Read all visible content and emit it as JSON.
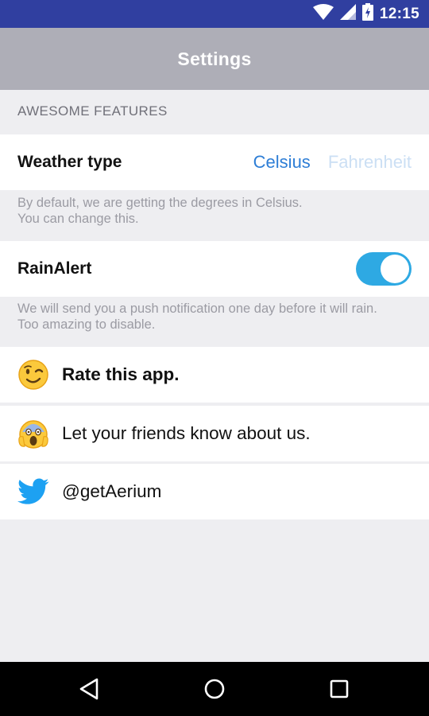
{
  "status_bar": {
    "time": "12:15",
    "icons": [
      "wifi-icon",
      "signal-icon",
      "battery-charging-icon"
    ]
  },
  "app_bar": {
    "title": "Settings"
  },
  "section": {
    "header": "AWESOME FEATURES"
  },
  "weather": {
    "label": "Weather type",
    "options": [
      "Celsius",
      "Fahrenheit"
    ],
    "selected": "Celsius",
    "hint_line1": "By default, we are getting the degrees in Celsius.",
    "hint_line2": "You can change this."
  },
  "rain_alert": {
    "label": "RainAlert",
    "enabled": true,
    "hint_line1": "We will send you a push notification one day before it will rain.",
    "hint_line2": "Too amazing to disable."
  },
  "links": [
    {
      "icon": "winking-face-icon",
      "label": "Rate this app."
    },
    {
      "icon": "screaming-face-icon",
      "label": "Let your friends know about us."
    },
    {
      "icon": "twitter-bird-icon",
      "label": "@getAerium"
    }
  ],
  "colors": {
    "status_bar": "#303fa0",
    "app_bar": "#aeaeb7",
    "accent": "#2e7ed6",
    "toggle_on": "#2ea9e3",
    "twitter": "#1da1f2"
  },
  "nav_bar": {
    "buttons": [
      "back-icon",
      "home-icon",
      "recents-icon"
    ]
  }
}
